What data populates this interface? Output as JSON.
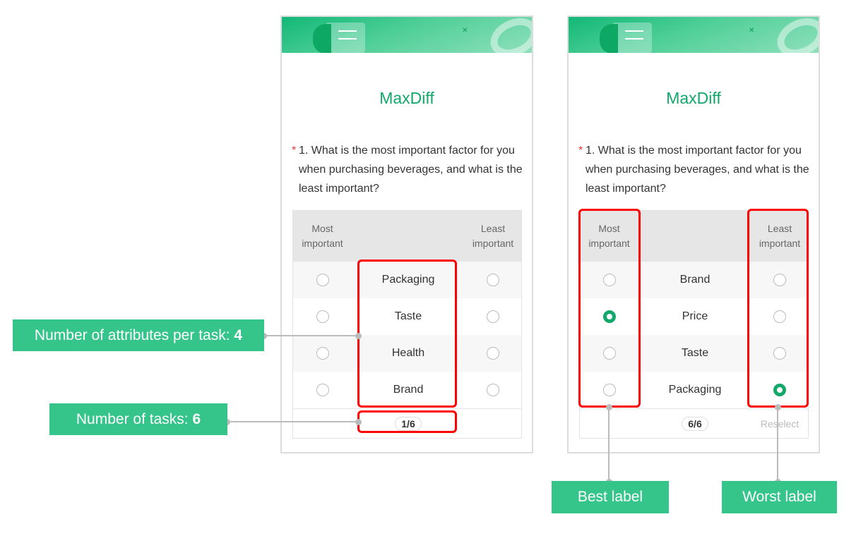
{
  "left_screen": {
    "title": "MaxDiff",
    "question": {
      "required_mark": "*",
      "text": "1. What is the most important factor for you when purchasing beverages, and what is the least important?"
    },
    "headers": {
      "most": "Most important",
      "least": "Least important"
    },
    "rows": [
      {
        "label": "Packaging",
        "most": false,
        "least": false
      },
      {
        "label": "Taste",
        "most": false,
        "least": false
      },
      {
        "label": "Health",
        "most": false,
        "least": false
      },
      {
        "label": "Brand",
        "most": false,
        "least": false
      }
    ],
    "pager": "1/6"
  },
  "right_screen": {
    "title": "MaxDiff",
    "question": {
      "required_mark": "*",
      "text": "1. What is the most important factor for you when purchasing beverages, and what is the least important?"
    },
    "headers": {
      "most": "Most important",
      "least": "Least important"
    },
    "rows": [
      {
        "label": "Brand",
        "most": false,
        "least": false
      },
      {
        "label": "Price",
        "most": true,
        "least": false
      },
      {
        "label": "Taste",
        "most": false,
        "least": false
      },
      {
        "label": "Packaging",
        "most": false,
        "least": true
      }
    ],
    "pager": "6/6",
    "reselect": "Reselect"
  },
  "annotations": {
    "attributes": {
      "text": "Number of attributes per task: ",
      "value": "4"
    },
    "tasks": {
      "text": "Number of tasks: ",
      "value": "6"
    },
    "best": "Best label",
    "worst": "Worst label"
  },
  "colors": {
    "accent": "#12a86a",
    "annotation_bg": "#35c58b",
    "highlight": "#ff0000"
  }
}
